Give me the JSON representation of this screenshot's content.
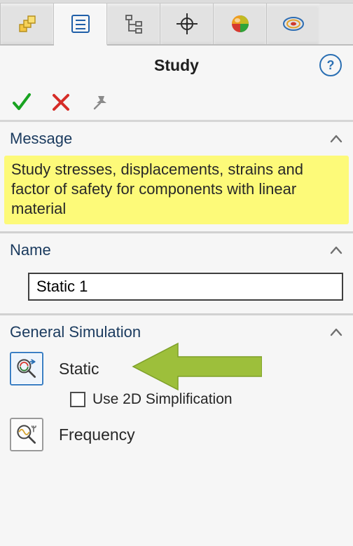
{
  "title": "Study",
  "help_tooltip": "?",
  "actions": {
    "ok": "OK",
    "cancel": "Cancel",
    "pin": "Pin"
  },
  "tabs": [
    {
      "id": "features-tab"
    },
    {
      "id": "property-manager-tab"
    },
    {
      "id": "configuration-tab"
    },
    {
      "id": "dimxpert-tab"
    },
    {
      "id": "appearance-tab"
    },
    {
      "id": "simulation-tab"
    }
  ],
  "sections": {
    "message": {
      "title": "Message",
      "text": "Study stresses, displacements, strains and factor of safety for components with linear material"
    },
    "name": {
      "title": "Name",
      "value": "Static 1"
    },
    "general_simulation": {
      "title": "General Simulation",
      "items": [
        {
          "id": "static",
          "label": "Static",
          "selected": true,
          "sub_option": {
            "label": "Use 2D Simplification",
            "checked": false
          }
        },
        {
          "id": "frequency",
          "label": "Frequency",
          "selected": false
        }
      ]
    }
  }
}
